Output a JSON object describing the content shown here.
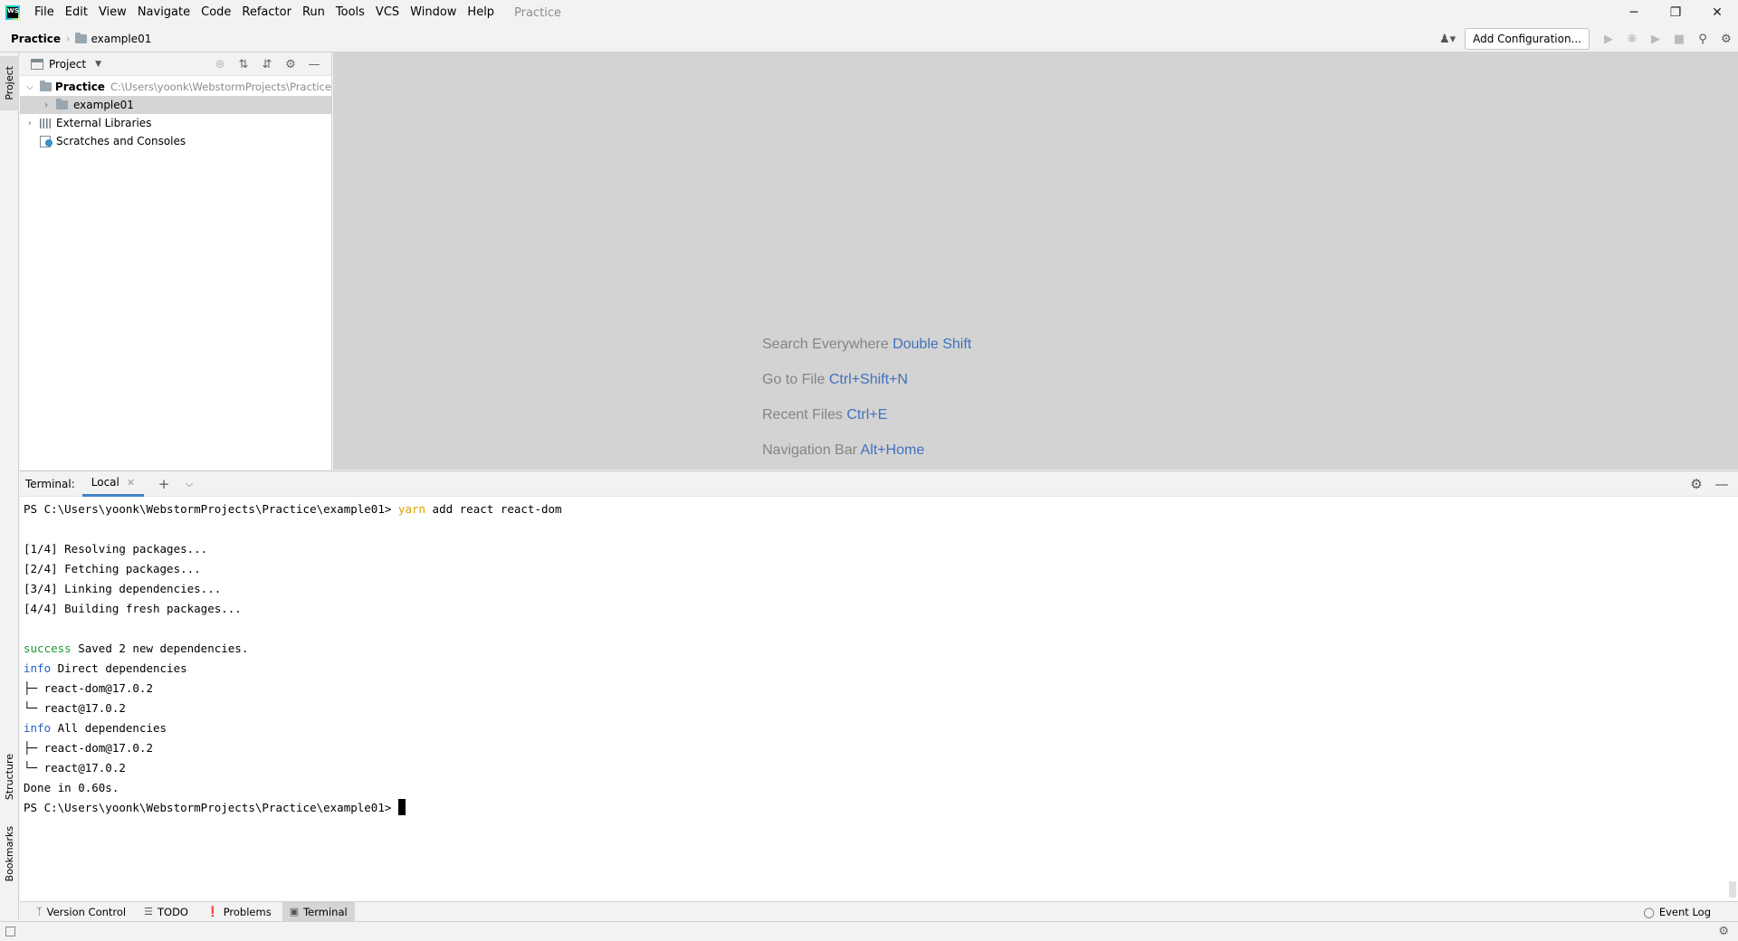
{
  "window": {
    "title": "Practice",
    "menu": [
      "File",
      "Edit",
      "View",
      "Navigate",
      "Code",
      "Refactor",
      "Run",
      "Tools",
      "VCS",
      "Window",
      "Help"
    ],
    "controls": {
      "minimize": "─",
      "restore": "❐",
      "close": "✕"
    }
  },
  "navbar": {
    "project": "Practice",
    "folder": "example01",
    "add_configuration": "Add Configuration..."
  },
  "stripe": {
    "project": "Project",
    "structure": "Structure",
    "bookmarks": "Bookmarks"
  },
  "project_panel": {
    "title": "Project",
    "tree": {
      "root_name": "Practice",
      "root_path": "C:\\Users\\yoonk\\WebstormProjects\\Practice",
      "child_folder": "example01",
      "external_libraries": "External Libraries",
      "scratches": "Scratches and Consoles"
    }
  },
  "editor_hints": [
    {
      "label": "Search Everywhere",
      "key": "Double Shift"
    },
    {
      "label": "Go to File",
      "key": "Ctrl+Shift+N"
    },
    {
      "label": "Recent Files",
      "key": "Ctrl+E"
    },
    {
      "label": "Navigation Bar",
      "key": "Alt+Home"
    }
  ],
  "terminal": {
    "title": "Terminal:",
    "tab_label": "Local",
    "prompt": "PS C:\\Users\\yoonk\\WebstormProjects\\Practice\\example01>",
    "cmd_yarn": "yarn",
    "cmd_rest": " add react react-dom",
    "step1": "[1/4] Resolving packages...",
    "step2": "[2/4] Fetching packages...",
    "step3": "[3/4] Linking dependencies...",
    "step4": "[4/4] Building fresh packages...",
    "success_word": "success",
    "success_msg": " Saved 2 new dependencies.",
    "info_word": "info",
    "info_direct": " Direct dependencies",
    "dep1": "├─ react-dom@17.0.2",
    "dep2": "└─ react@17.0.2",
    "info_all": " All dependencies",
    "done": "Done in 0.60s."
  },
  "bottom_tabs": {
    "version_control": "Version Control",
    "todo": "TODO",
    "problems": "Problems",
    "terminal": "Terminal",
    "event_log": "Event Log"
  }
}
